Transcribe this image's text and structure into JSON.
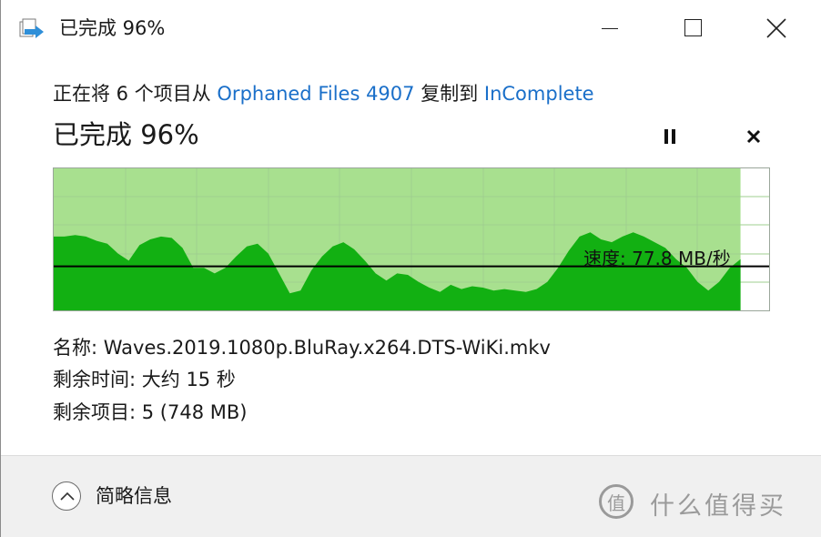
{
  "window": {
    "title": "已完成 96%"
  },
  "header": {
    "copy_prefix": "正在将 6 个项目从",
    "source": "Orphaned Files 4907",
    "copy_middle": "复制到",
    "destination": "InComplete",
    "progress_title": "已完成 96%"
  },
  "graph": {
    "speed_label": "速度: 77.8 MB/秒",
    "progress_fraction": 0.96,
    "current_speed_fraction": 0.31,
    "colors": {
      "progress_fill": "#a8e08f",
      "speed_fill": "#12b012",
      "grid": "#9fcf8f",
      "speed_line": "#000000"
    },
    "speed_samples": [
      0.52,
      0.52,
      0.53,
      0.52,
      0.49,
      0.47,
      0.4,
      0.35,
      0.46,
      0.5,
      0.52,
      0.51,
      0.44,
      0.3,
      0.3,
      0.26,
      0.3,
      0.38,
      0.45,
      0.47,
      0.4,
      0.26,
      0.12,
      0.14,
      0.28,
      0.38,
      0.45,
      0.48,
      0.43,
      0.35,
      0.26,
      0.21,
      0.26,
      0.25,
      0.2,
      0.16,
      0.13,
      0.18,
      0.15,
      0.17,
      0.16,
      0.14,
      0.15,
      0.14,
      0.13,
      0.15,
      0.2,
      0.3,
      0.42,
      0.52,
      0.55,
      0.5,
      0.48,
      0.52,
      0.55,
      0.52,
      0.48,
      0.44,
      0.36,
      0.3,
      0.2,
      0.14,
      0.2,
      0.3,
      0.36
    ]
  },
  "details": {
    "name_label": "名称:",
    "name_value": "Waves.2019.1080p.BluRay.x264.DTS-WiKi.mkv",
    "time_label": "剩余时间:",
    "time_value": "大约 15 秒",
    "items_label": "剩余项目:",
    "items_value": "5 (748 MB)"
  },
  "footer": {
    "toggle_label": "简略信息"
  },
  "watermark": {
    "badge": "值",
    "text": "什么值得买"
  },
  "icons": {
    "app": "file-copy-icon",
    "minimize": "minimize-icon",
    "maximize": "maximize-icon",
    "close": "close-icon",
    "pause": "pause-icon",
    "cancel": "cancel-icon",
    "toggle": "chevron-up-icon"
  }
}
